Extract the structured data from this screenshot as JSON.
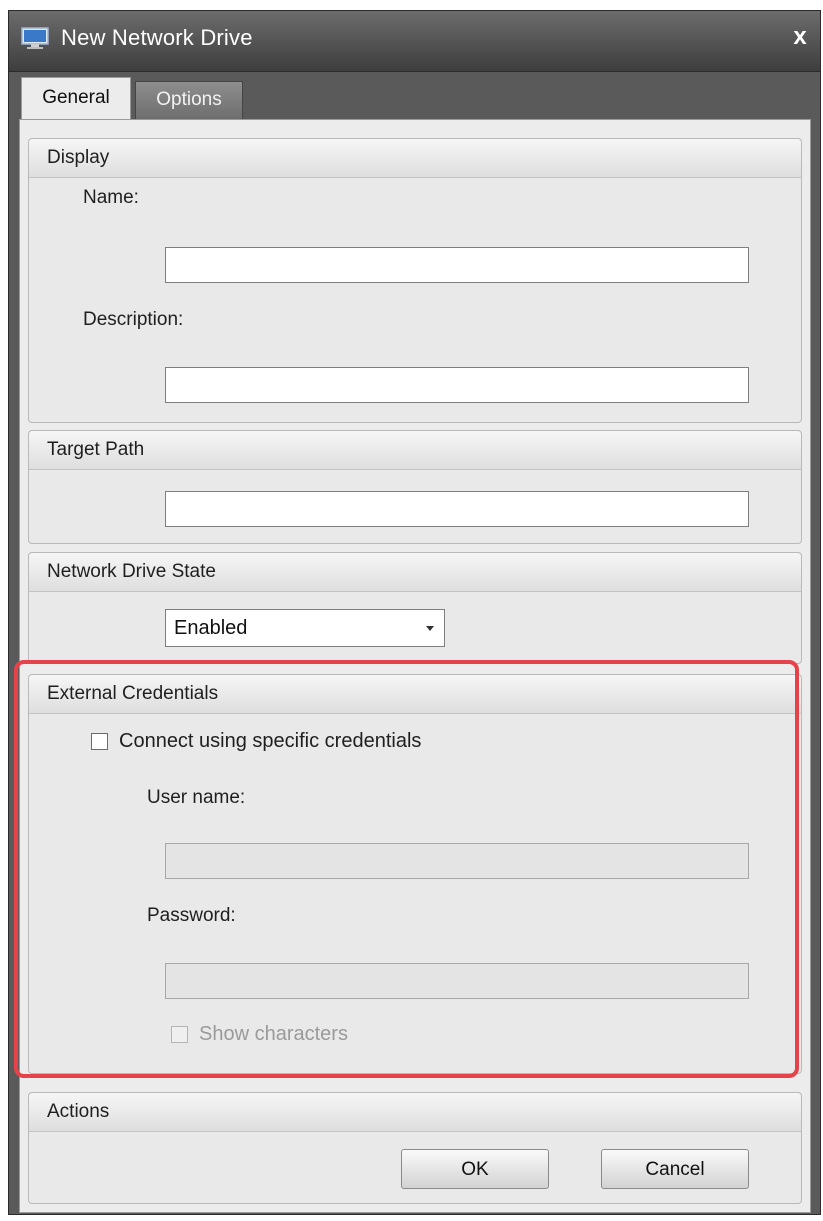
{
  "window": {
    "title": "New Network Drive",
    "close_glyph": "x",
    "icon": "network-drive-icon"
  },
  "tabs": [
    {
      "label": "General",
      "active": true
    },
    {
      "label": "Options",
      "active": false
    }
  ],
  "display": {
    "header": "Display",
    "name_label": "Name:",
    "name_value": "",
    "description_label": "Description:",
    "description_value": ""
  },
  "target_path": {
    "header": "Target Path",
    "value": ""
  },
  "state": {
    "header": "Network Drive State",
    "selected": "Enabled"
  },
  "credentials": {
    "header": "External Credentials",
    "connect_label": "Connect using specific credentials",
    "connect_checked": false,
    "username_label": "User name:",
    "username_value": "",
    "password_label": "Password:",
    "password_value": "",
    "show_chars_label": "Show characters",
    "show_chars_checked": false,
    "highlight_color": "#e5424a"
  },
  "actions": {
    "header": "Actions",
    "ok_label": "OK",
    "cancel_label": "Cancel"
  }
}
